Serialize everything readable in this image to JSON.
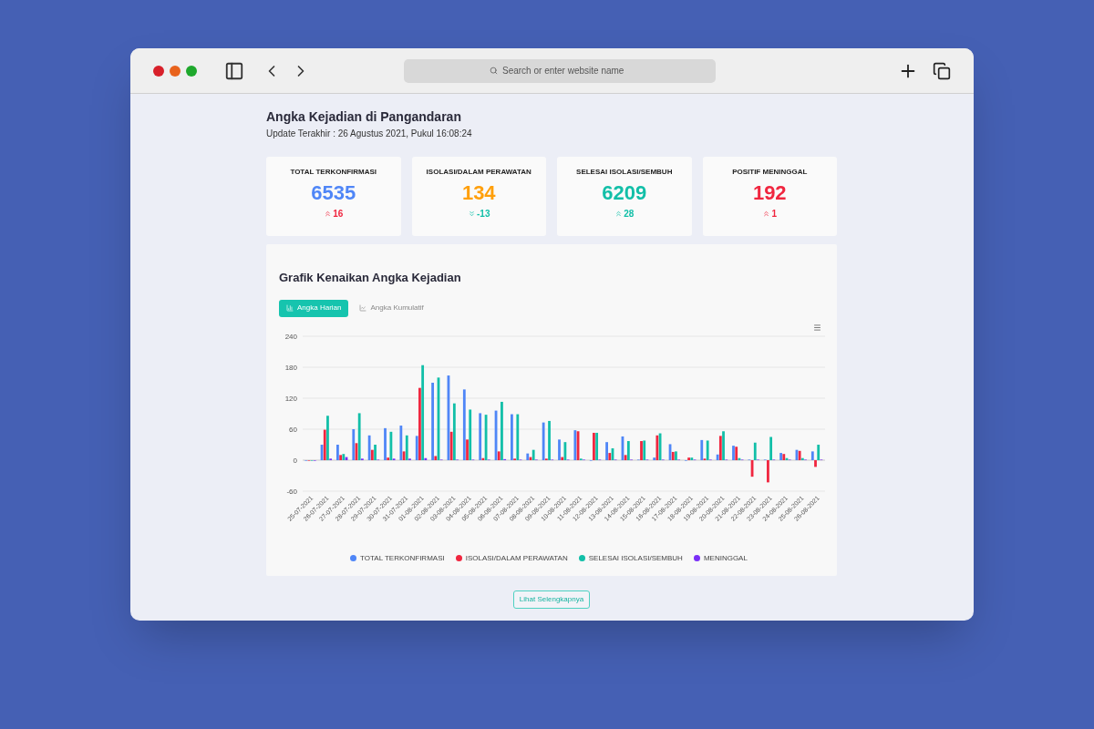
{
  "browser": {
    "address_bar": {
      "placeholder": "Search or enter website name"
    }
  },
  "page": {
    "title": "Angka Kejadian di Pangandaran",
    "subtitle": "Update Terakhir : 26 Agustus 2021, Pukul 16:08:24"
  },
  "stats": [
    {
      "label": "TOTAL TERKONFIRMASI",
      "value": "6535",
      "color": "#4f86f7",
      "change": {
        "text": "16",
        "kind": "up",
        "color": "#f0263f"
      }
    },
    {
      "label": "ISOLASI/DALAM PERAWATAN",
      "value": "134",
      "color": "#ff9f0a",
      "change": {
        "text": "-13",
        "kind": "down",
        "color": "#12bfa8"
      }
    },
    {
      "label": "SELESAI ISOLASI/SEMBUH",
      "value": "6209",
      "color": "#12bfa8",
      "change": {
        "text": "28",
        "kind": "up",
        "color": "#12bfa8"
      }
    },
    {
      "label": "POSITIF MENINGGAL",
      "value": "192",
      "color": "#f0263f",
      "change": {
        "text": "1",
        "kind": "up",
        "color": "#f0263f"
      }
    }
  ],
  "chart_card": {
    "title": "Grafik Kenaikan Angka Kejadian",
    "tabs": [
      {
        "label": "Angka Harian",
        "selected": true
      },
      {
        "label": "Angka Kumulatif",
        "selected": false
      }
    ],
    "chart_data": {
      "type": "bar",
      "categories": [
        "25-07-2021",
        "26-07-2021",
        "27-07-2021",
        "28-07-2021",
        "29-07-2021",
        "30-07-2021",
        "31-07-2021",
        "01-08-2021",
        "02-08-2021",
        "03-08-2021",
        "04-08-2021",
        "05-08-2021",
        "06-08-2021",
        "07-08-2021",
        "08-08-2021",
        "09-08-2021",
        "10-08-2021",
        "11-08-2021",
        "12-08-2021",
        "13-08-2021",
        "14-08-2021",
        "15-08-2021",
        "16-08-2021",
        "17-08-2021",
        "18-08-2021",
        "19-08-2021",
        "20-08-2021",
        "21-08-2021",
        "22-08-2021",
        "23-08-2021",
        "24-08-2021",
        "25-08-2021",
        "26-08-2021"
      ],
      "series": [
        {
          "name": "TOTAL TERKONFIRMASI",
          "color": "#4f86f7",
          "values": [
            0,
            30,
            30,
            60,
            48,
            62,
            67,
            47,
            150,
            164,
            137,
            91,
            96,
            89,
            13,
            73,
            40,
            58,
            0,
            35,
            46,
            1,
            5,
            31,
            0,
            39,
            11,
            28,
            1,
            1,
            14,
            20,
            17
          ]
        },
        {
          "name": "ISOLASI/DALAM PERAWATAN",
          "color": "#f0263f",
          "values": [
            0,
            59,
            10,
            33,
            20,
            5,
            17,
            140,
            8,
            55,
            40,
            4,
            17,
            3,
            6,
            3,
            6,
            56,
            53,
            14,
            10,
            37,
            48,
            16,
            5,
            3,
            47,
            26,
            -32,
            -43,
            12,
            18,
            -13
          ]
        },
        {
          "name": "SELESAI ISOLASI/SEMBUH",
          "color": "#12bfa8",
          "values": [
            0,
            86,
            12,
            91,
            30,
            55,
            48,
            184,
            160,
            110,
            98,
            88,
            113,
            89,
            20,
            76,
            35,
            3,
            53,
            23,
            37,
            38,
            52,
            17,
            5,
            38,
            56,
            4,
            34,
            45,
            4,
            4,
            30
          ]
        },
        {
          "name": "MENINGGAL",
          "color": "#7a2ff7",
          "values": [
            0,
            3,
            6,
            3,
            1,
            3,
            3,
            4,
            1,
            1,
            1,
            1,
            2,
            1,
            1,
            1,
            1,
            1,
            1,
            1,
            1,
            1,
            1,
            1,
            1,
            1,
            1,
            1,
            1,
            1,
            1,
            1,
            1
          ]
        }
      ],
      "ylim": [
        -60,
        240
      ],
      "yticks": [
        -60,
        0,
        60,
        120,
        180,
        240
      ],
      "grid": true,
      "legend": true
    }
  },
  "more_button": {
    "label": "Lihat Selengkapnya"
  }
}
